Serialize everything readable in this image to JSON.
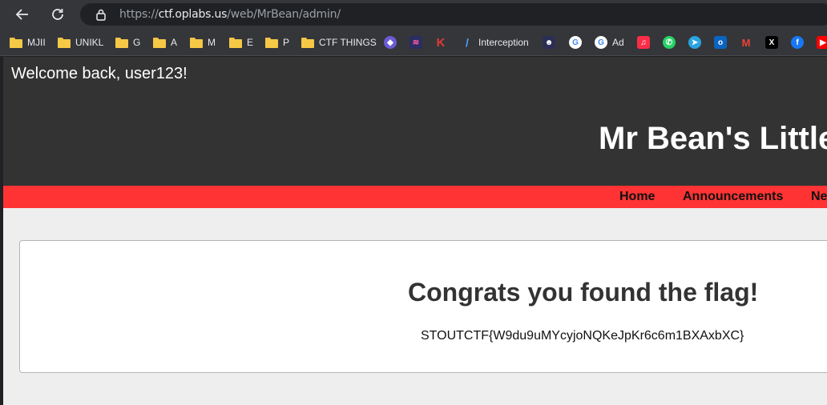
{
  "browser": {
    "url_scheme": "https://",
    "url_host": "ctf.oplabs.us",
    "url_path": "/web/MrBean/admin/"
  },
  "bookmarks": [
    {
      "label": "MJII",
      "icon": "folder-icon"
    },
    {
      "label": "UNIKL",
      "icon": "folder-icon"
    },
    {
      "label": "G",
      "icon": "folder-icon"
    },
    {
      "label": "A",
      "icon": "folder-icon"
    },
    {
      "label": "M",
      "icon": "folder-icon"
    },
    {
      "label": "E",
      "icon": "folder-icon"
    },
    {
      "label": "P",
      "icon": "folder-icon"
    },
    {
      "label": "CTF THINGS",
      "icon": "folder-icon"
    },
    {
      "label": "Interception",
      "icon": "interception-icon"
    },
    {
      "label": "Ad",
      "icon": "google-icon"
    }
  ],
  "site": {
    "welcome": "Welcome back, user123!",
    "title": "Mr Bean's Little",
    "nav": [
      "Home",
      "Announcements",
      "Ne"
    ]
  },
  "content": {
    "heading": "Congrats you found the flag!",
    "flag": "STOUTCTF{W9du9uMYcyjoNQKeJpKr6c6m1BXAxbXC}"
  },
  "colors": {
    "header_bg": "#333333",
    "nav_bg": "#ff3333",
    "page_bg": "#eeeeee",
    "folder": "#f5c846"
  }
}
